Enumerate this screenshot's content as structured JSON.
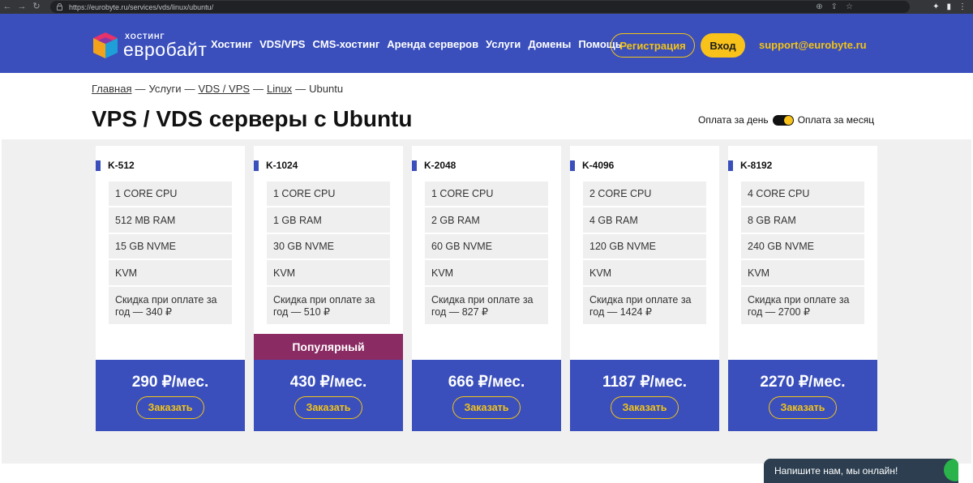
{
  "browser": {
    "url": "https://eurobyte.ru/services/vds/linux/ubuntu/"
  },
  "header": {
    "logo_top": "ХОСТИНГ",
    "logo_main": "евробайт",
    "menu": [
      "Хостинг",
      "VDS/VPS",
      "CMS-хостинг",
      "Аренда серверов",
      "Услуги",
      "Домены",
      "Помощь"
    ],
    "register_label": "Регистрация",
    "login_label": "Вход",
    "support_email": "support@eurobyte.ru"
  },
  "breadcrumb": {
    "items": [
      "Главная",
      "Услуги",
      "VDS / VPS",
      "Linux",
      "Ubuntu"
    ],
    "separator": "—"
  },
  "page_title": "VPS / VDS серверы с Ubuntu",
  "billing": {
    "left_label": "Оплата за день",
    "right_label": "Оплата за месяц",
    "monthly_selected": true
  },
  "plans": [
    {
      "name": "K-512",
      "cpu": "1 CORE CPU",
      "ram": "512 MB RAM",
      "disk": "15 GB NVME",
      "virt": "KVM",
      "discount": "Скидка при оплате за год — 340 ₽",
      "price": "290 ₽/мес.",
      "order": "Заказать"
    },
    {
      "name": "K-1024",
      "cpu": "1 CORE CPU",
      "ram": "1 GB RAM",
      "disk": "30 GB NVME",
      "virt": "KVM",
      "discount": "Скидка при оплате за год — 510 ₽",
      "price": "430 ₽/мес.",
      "order": "Заказать",
      "badge": "Популярный"
    },
    {
      "name": "K-2048",
      "cpu": "1 CORE CPU",
      "ram": "2 GB RAM",
      "disk": "60 GB NVME",
      "virt": "KVM",
      "discount": "Скидка при оплате за год — 827 ₽",
      "price": "666 ₽/мес.",
      "order": "Заказать"
    },
    {
      "name": "K-4096",
      "cpu": "2 CORE CPU",
      "ram": "4 GB RAM",
      "disk": "120 GB NVME",
      "virt": "KVM",
      "discount": "Скидка при оплате за год — 1424 ₽",
      "price": "1187 ₽/мес.",
      "order": "Заказать"
    },
    {
      "name": "K-8192",
      "cpu": "4 CORE CPU",
      "ram": "8 GB RAM",
      "disk": "240 GB NVME",
      "virt": "KVM",
      "discount": "Скидка при оплате за год — 2700 ₽",
      "price": "2270 ₽/мес.",
      "order": "Заказать"
    }
  ],
  "chat": {
    "label": "Напишите нам, мы онлайн!"
  },
  "colors": {
    "brand_blue": "#3a4fbc",
    "accent_yellow": "#f8c21a",
    "popular_purple": "#8b2b63"
  }
}
